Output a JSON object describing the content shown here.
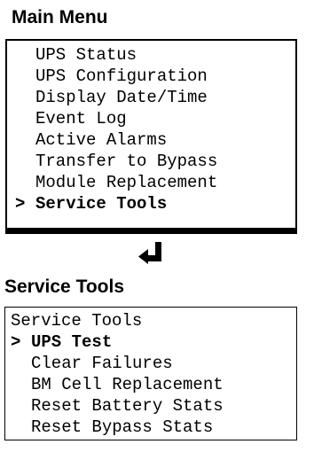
{
  "main_menu": {
    "title": "Main Menu",
    "cursor": ">",
    "items": [
      {
        "label": "UPS Status",
        "selected": false
      },
      {
        "label": "UPS Configuration",
        "selected": false
      },
      {
        "label": "Display Date/Time",
        "selected": false
      },
      {
        "label": "Event Log",
        "selected": false
      },
      {
        "label": "Active Alarms",
        "selected": false
      },
      {
        "label": "Transfer to Bypass",
        "selected": false
      },
      {
        "label": "Module Replacement",
        "selected": false
      },
      {
        "label": "Service Tools",
        "selected": true
      }
    ]
  },
  "navigation": {
    "icon": "enter-return-icon"
  },
  "service_tools": {
    "title": "Service Tools",
    "cursor": ">",
    "header": "Service Tools",
    "items": [
      {
        "label": "UPS Test",
        "selected": true
      },
      {
        "label": "Clear Failures",
        "selected": false
      },
      {
        "label": "BM Cell Replacement",
        "selected": false
      },
      {
        "label": "Reset Battery Stats",
        "selected": false
      },
      {
        "label": "Reset Bypass Stats",
        "selected": false
      }
    ]
  },
  "colors": {
    "text": "#000000",
    "background": "#ffffff"
  }
}
